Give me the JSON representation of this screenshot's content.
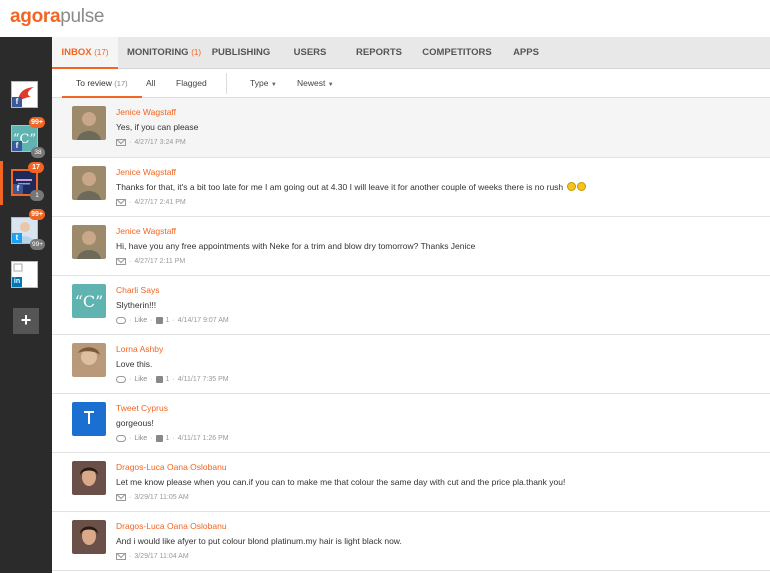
{
  "brand": {
    "part1": "agora",
    "part2": "pulse"
  },
  "colors": {
    "accent": "#f26522",
    "sidebar": "#2b2b2b",
    "facebook": "#3b5998",
    "twitter": "#1da1f2",
    "linkedin": "#0077b5"
  },
  "nav": {
    "tabs": [
      {
        "label": "INBOX",
        "count": "(17)"
      },
      {
        "label": "MONITORING",
        "count": "(1)"
      },
      {
        "label": "PUBLISHING",
        "count": ""
      },
      {
        "label": "USERS",
        "count": ""
      },
      {
        "label": "REPORTS",
        "count": ""
      },
      {
        "label": "COMPETITORS",
        "count": ""
      },
      {
        "label": "APPS",
        "count": ""
      }
    ]
  },
  "filters": {
    "to_review": "To review",
    "to_review_count": "(17)",
    "all": "All",
    "flagged": "Flagged",
    "type": "Type",
    "sort": "Newest"
  },
  "sidebar": {
    "accounts": [
      {
        "name": "page-facebook",
        "network": "f",
        "badge": "",
        "sub": "",
        "icon": "flame-logo-icon"
      },
      {
        "name": "charli-says",
        "network": "f",
        "badge": "99+",
        "sub": "38",
        "icon": "quote-logo-icon"
      },
      {
        "name": "salon-page",
        "network": "f",
        "badge": "17",
        "sub": "1",
        "icon": "salon-logo-icon"
      },
      {
        "name": "twitter-account",
        "network": "t",
        "badge": "99+",
        "sub": "99+",
        "icon": "person-photo-icon"
      },
      {
        "name": "linkedin-account",
        "network": "in",
        "badge": "",
        "sub": "",
        "icon": "broken-image-icon"
      }
    ],
    "add": "+"
  },
  "messages": [
    {
      "author": "Jenice Wagstaff",
      "text": "Yes, if you can please",
      "meta": "4/27/17 3:24 PM",
      "kind": "pm",
      "emoji": false
    },
    {
      "author": "Jenice Wagstaff",
      "text": "Thanks for that, it's a bit too late for me I am going out at 4.30 I will leave it for another couple of weeks there is no rush",
      "meta": "4/27/17 2:41 PM",
      "kind": "pm",
      "emoji": true
    },
    {
      "author": "Jenice Wagstaff",
      "text": "Hi, have you any free appointments with Neke for a trim and blow dry tomorrow? Thanks Jenice",
      "meta": "4/27/17 2:11 PM",
      "kind": "pm",
      "emoji": false
    },
    {
      "author": "Charli Says",
      "text": "Slytherin!!!",
      "like": "Like",
      "likes": "1",
      "meta": "4/14/17 9:07 AM",
      "kind": "comment",
      "emoji": false
    },
    {
      "author": "Lorna Ashby",
      "text": "Love this.",
      "like": "Like",
      "likes": "1",
      "meta": "4/11/17 7:35 PM",
      "kind": "comment",
      "emoji": false
    },
    {
      "author": "Tweet Cyprus",
      "text": "gorgeous!",
      "like": "Like",
      "likes": "1",
      "meta": "4/11/17 1:26 PM",
      "kind": "comment",
      "emoji": false
    },
    {
      "author": "Dragos-Luca Oana Oslobanu",
      "text": "Let me know please when you can.if you can to make me that colour the same day with cut and the price pla.thank you!",
      "meta": "3/29/17 11:05 AM",
      "kind": "pm",
      "emoji": false
    },
    {
      "author": "Dragos-Luca Oana Oslobanu",
      "text": "And i would like afyer to put colour blond platinum.my hair is light black now.",
      "meta": "3/29/17 11:04 AM",
      "kind": "pm",
      "emoji": false
    }
  ]
}
